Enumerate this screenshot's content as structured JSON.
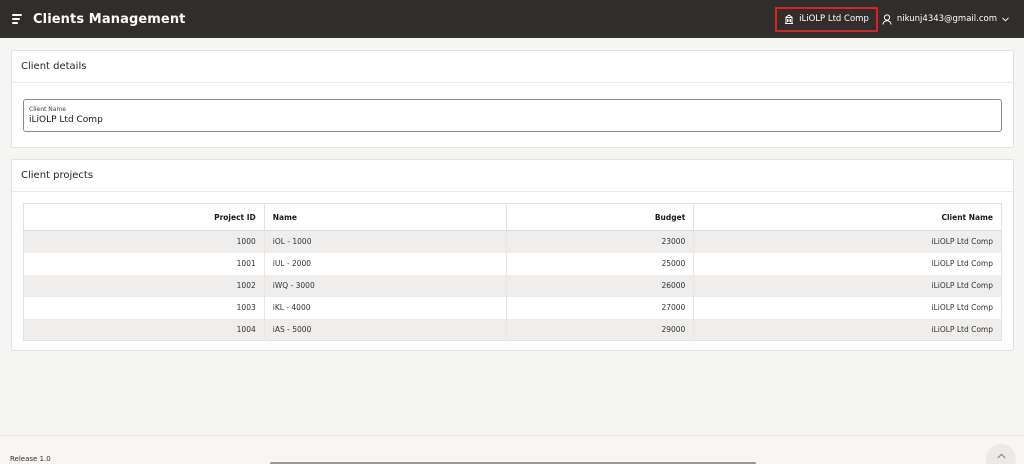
{
  "header": {
    "title": "Clients Management",
    "company": "iLiOLP Ltd Comp",
    "user_email": "nikunj4343@gmail.com"
  },
  "client_details": {
    "heading": "Client details",
    "name_label": "Client Name",
    "name_value": "iLiOLP Ltd Comp"
  },
  "client_projects": {
    "heading": "Client projects",
    "columns": [
      "Project ID",
      "Name",
      "Budget",
      "Client Name"
    ],
    "rows": [
      [
        "1000",
        "iOL - 1000",
        "23000",
        "iLiOLP Ltd Comp"
      ],
      [
        "1001",
        "iUL - 2000",
        "25000",
        "iLiOLP Ltd Comp"
      ],
      [
        "1002",
        "iWQ - 3000",
        "26000",
        "iLiOLP Ltd Comp"
      ],
      [
        "1003",
        "iKL - 4000",
        "27000",
        "iLiOLP Ltd Comp"
      ],
      [
        "1004",
        "iAS - 5000",
        "29000",
        "iLiOLP Ltd Comp"
      ]
    ]
  },
  "footer": {
    "release": "Release 1.0"
  },
  "colors": {
    "header_bg": "#312d2a",
    "highlight_border": "#d8212b",
    "row_stripe": "#efeeed"
  },
  "icons": [
    "menu-icon",
    "building-icon",
    "user-icon",
    "chevron-down-icon",
    "chevron-up-icon"
  ]
}
